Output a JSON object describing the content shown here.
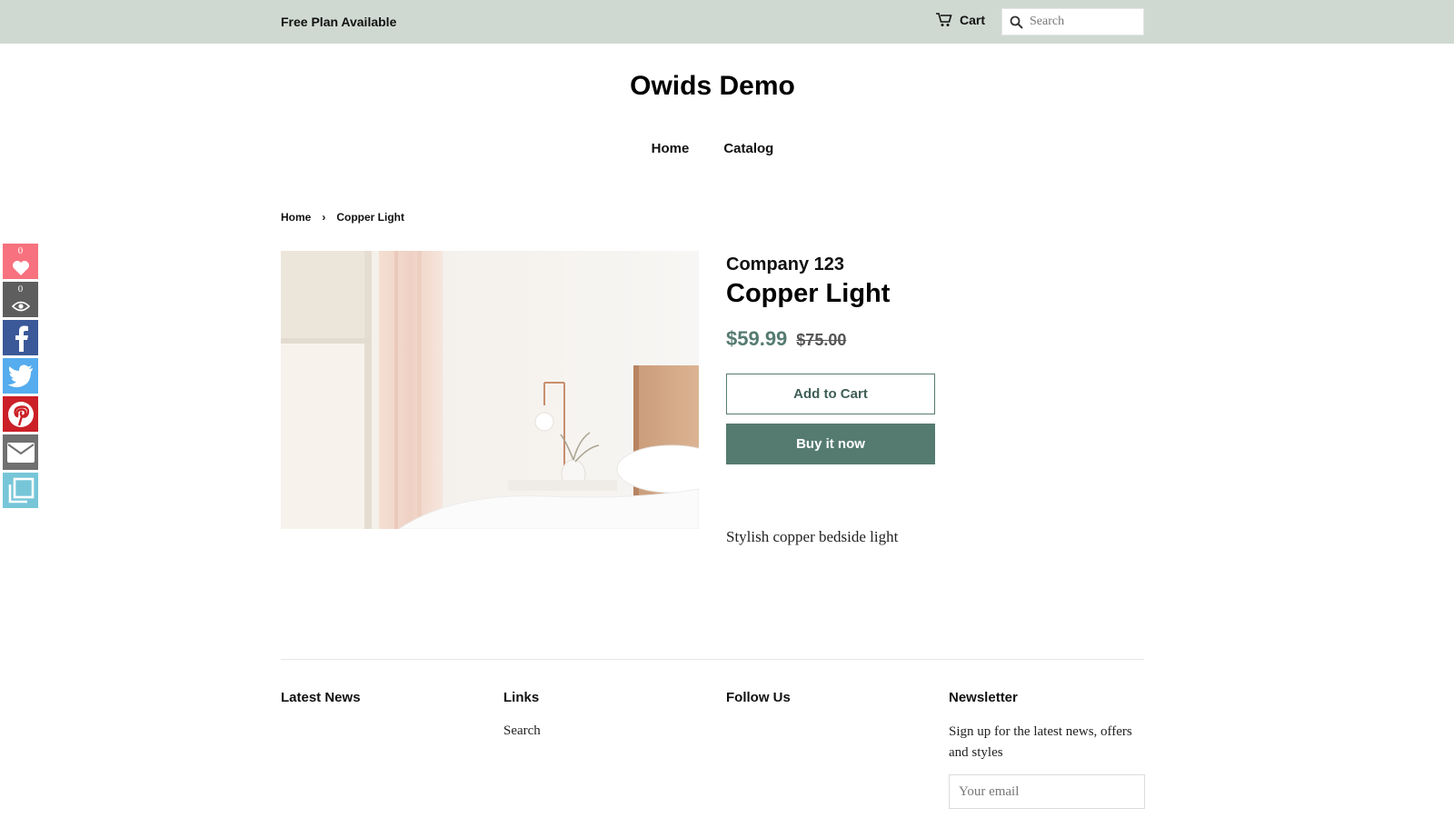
{
  "announcement": {
    "text": "Free Plan Available"
  },
  "header": {
    "cart_label": "Cart",
    "search_placeholder": "Search",
    "search_value": ""
  },
  "site": {
    "title": "Owids Demo"
  },
  "nav": {
    "items": [
      "Home",
      "Catalog"
    ]
  },
  "breadcrumb": {
    "home": "Home",
    "separator": "›",
    "current": "Copper Light"
  },
  "product": {
    "vendor": "Company 123",
    "title": "Copper Light",
    "price": "$59.99",
    "compare_price": "$75.00",
    "add_to_cart_label": "Add to Cart",
    "buy_now_label": "Buy it now",
    "description": "Stylish copper bedside light"
  },
  "social": {
    "favorites_count": "0",
    "views_count": "0",
    "buttons": [
      "heart-icon",
      "eye-icon",
      "facebook-icon",
      "twitter-icon",
      "pinterest-icon",
      "email-icon",
      "copy-icon"
    ],
    "colors": {
      "heart": "#f7727e",
      "eye": "#5e5e5e",
      "facebook": "#3b5998",
      "twitter": "#55acee",
      "pinterest": "#cb2027",
      "email": "#707070",
      "copy": "#76c6d8"
    }
  },
  "footer": {
    "latest_news_heading": "Latest News",
    "links_heading": "Links",
    "links": [
      "Search"
    ],
    "follow_heading": "Follow Us",
    "newsletter_heading": "Newsletter",
    "newsletter_text": "Sign up for the latest news, offers and styles",
    "email_placeholder": "Your email"
  },
  "colors": {
    "announce_bar": "#cfd9d2",
    "accent": "#557b71"
  }
}
